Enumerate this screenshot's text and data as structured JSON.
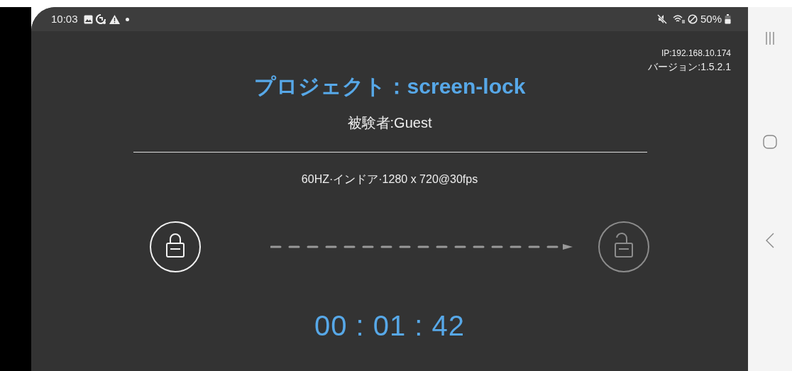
{
  "status_bar": {
    "time": "10:03",
    "battery_text": "50%"
  },
  "ip": "IP:192.168.10.174",
  "version": "バージョン:1.5.2.1",
  "title": "プロジェクト：screen-lock",
  "subject": "被験者:Guest",
  "settings_line": "60HZ·インドア·1280 x 720@30fps",
  "locks": [
    {
      "kind": "locked"
    },
    {
      "kind": "unlocked"
    }
  ],
  "timer": "00 : 01 : 42"
}
